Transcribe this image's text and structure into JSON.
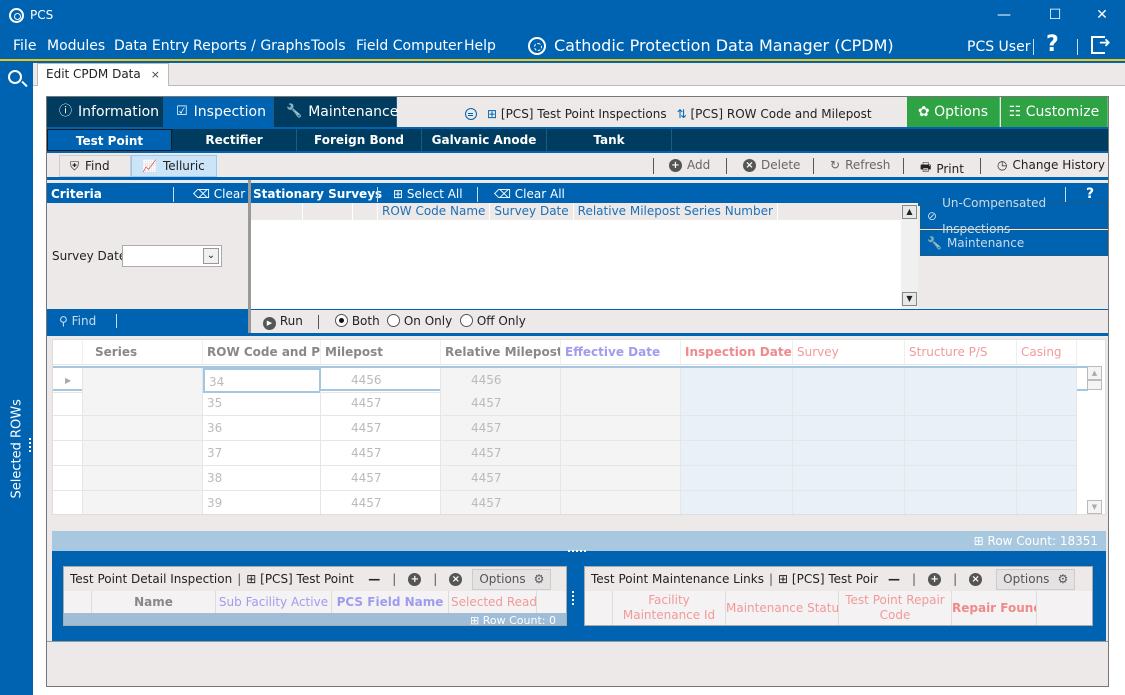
{
  "window": {
    "app_name": "PCS",
    "controls": {
      "minimize": "—",
      "maximize": "☐",
      "close": "✕"
    }
  },
  "menu": {
    "items": [
      "File",
      "Modules",
      "Data Entry",
      "Reports / Graphs",
      "Tools",
      "Field Computer",
      "Help"
    ],
    "app_title": "Cathodic Protection Data Manager (CPDM)",
    "user": "PCS User",
    "help_glyph": "?"
  },
  "sidebar": {
    "label": "Selected ROWs"
  },
  "document_tab": {
    "label": "Edit CPDM Data",
    "close_glyph": "×"
  },
  "top_tabs": [
    {
      "label": "Information",
      "icon": "info-icon",
      "glyph": "ⓘ",
      "active": false
    },
    {
      "label": "Inspection",
      "icon": "checkbox-icon",
      "glyph": "☑",
      "active": true
    },
    {
      "label": "Maintenance",
      "icon": "wrench-icon",
      "glyph": "🔧",
      "active": false
    }
  ],
  "crumbs": {
    "view": "[PCS] Test Point Inspections",
    "sort": "[PCS] ROW Code and Milepost",
    "sort_glyph": "⇅"
  },
  "green_buttons": {
    "options": "Options",
    "customize": "Customize"
  },
  "sub_tabs": [
    "Test Point",
    "Rectifier",
    "Foreign Bond",
    "Galvanic Anode",
    "Tank"
  ],
  "toolbar": {
    "find": "Find",
    "telluric": "Telluric",
    "add": "Add",
    "delete": "Delete",
    "refresh": "Refresh",
    "print": "Print",
    "change_history": "Change History"
  },
  "criteria": {
    "title": "Criteria",
    "clear": "Clear",
    "survey_date_label": "Survey Date",
    "survey_date_value": "",
    "find": "Find"
  },
  "stationary_surveys": {
    "title": "Stationary Surveys",
    "select_all": "Select All",
    "clear_all": "Clear All",
    "help": "?",
    "columns": [
      "",
      "",
      "",
      "ROW Code Name",
      "Survey Date",
      "Relative Milepost Series Number"
    ],
    "side_buttons": [
      "Un-Compensated Inspections",
      "Maintenance"
    ],
    "run": "Run",
    "radio_options": [
      {
        "label": "Both",
        "selected": true
      },
      {
        "label": "On Only",
        "selected": false
      },
      {
        "label": "Off Only",
        "selected": false
      }
    ]
  },
  "main_grid": {
    "columns": [
      "",
      "Series",
      "ROW Code and Pipe",
      "Milepost",
      "Relative Milepost",
      "Effective Date",
      "Inspection Date",
      "Survey",
      "Structure P/S",
      "Casing"
    ],
    "rows": [
      {
        "series": "",
        "row_code": "34",
        "milepost": "4456",
        "relative_milepost": "4456",
        "selected": true
      },
      {
        "series": "",
        "row_code": "35",
        "milepost": "4457",
        "relative_milepost": "4457",
        "selected": false
      },
      {
        "series": "",
        "row_code": "36",
        "milepost": "4457",
        "relative_milepost": "4457",
        "selected": false
      },
      {
        "series": "",
        "row_code": "37",
        "milepost": "4457",
        "relative_milepost": "4457",
        "selected": false
      },
      {
        "series": "",
        "row_code": "38",
        "milepost": "4457",
        "relative_milepost": "4457",
        "selected": false
      },
      {
        "series": "",
        "row_code": "39",
        "milepost": "4457",
        "relative_milepost": "4457",
        "selected": false
      }
    ],
    "row_count_label": "Row Count:",
    "row_count": "18351"
  },
  "detail_panel": {
    "title": "Test Point Detail Inspection",
    "view": "[PCS] Test Point I",
    "options": "Options",
    "columns": [
      "",
      "Name",
      "Sub Facility Active",
      "PCS Field Name",
      "Selected Reading"
    ],
    "row_count_label": "Row Count:",
    "row_count": "0"
  },
  "maintenance_panel": {
    "title": "Test Point Maintenance Links",
    "view": "[PCS] Test Poin",
    "options": "Options",
    "columns": [
      "",
      "Facility Maintenance Id",
      "Maintenance Status",
      "Test Point Repair Code",
      "Repair Found D"
    ]
  },
  "colors": {
    "brand_blue": "#0063b1",
    "dark_navy": "#003c5f",
    "green": "#2ea343",
    "accent_yellow": "#f2c80f",
    "header_purple": "#9f9cf0",
    "header_red": "#f29a9a"
  }
}
